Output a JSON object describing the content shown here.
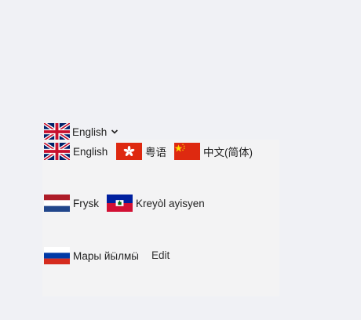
{
  "switcher": {
    "current_label": "English",
    "current_flag": "uk-flag-icon",
    "chevron": "chevron-down-icon"
  },
  "languages": [
    {
      "label": "English",
      "flag": "uk-flag-icon"
    },
    {
      "label": "粤语",
      "flag": "hong-kong-flag-icon"
    },
    {
      "label": "中文(简体)",
      "flag": "china-flag-icon"
    },
    {
      "label": "Frysk",
      "flag": "netherlands-flag-icon"
    },
    {
      "label": "Kreyòl ayisyen",
      "flag": "haiti-flag-icon"
    },
    {
      "label": "Мары йӹлмӹ",
      "flag": "russia-flag-icon"
    }
  ],
  "edit_label": "Edit",
  "colors": {
    "page_bg": "#f0f1f5",
    "panel_bg": "#f3f3f4",
    "uk_blue": "#012169",
    "uk_red": "#C8102E",
    "china_red": "#DE2910",
    "china_star": "#FFDE00"
  }
}
